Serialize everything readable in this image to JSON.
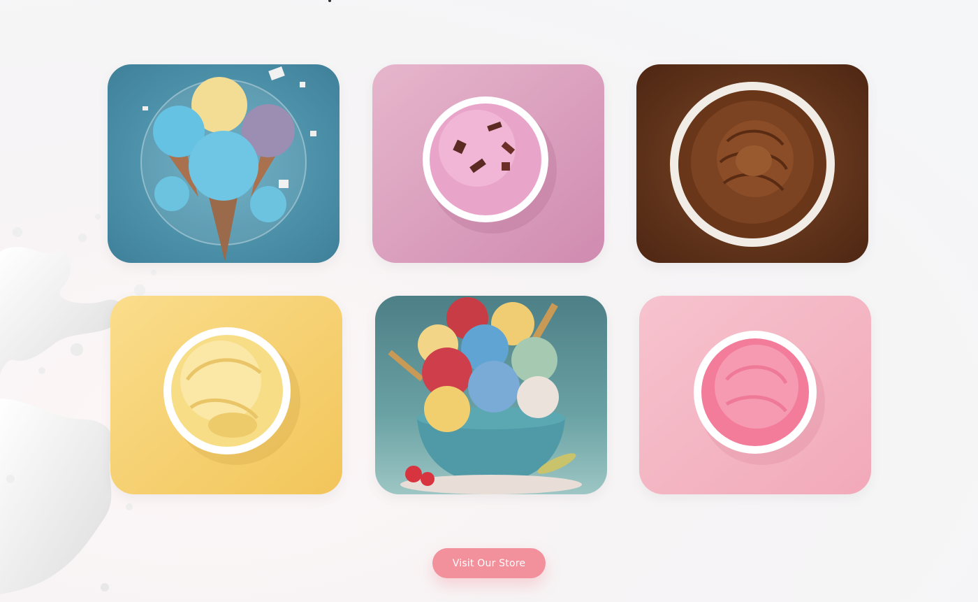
{
  "gallery": {
    "cards": [
      {
        "icon": "ice-cream-cones-bowl-image",
        "bg": "#4a8ea6",
        "accent": "#6cc3e0"
      },
      {
        "icon": "strawberry-chocolate-cup-image",
        "bg": "#dca6c2",
        "accent": "#e89ac0"
      },
      {
        "icon": "chocolate-cup-image",
        "bg": "#6b3a1f",
        "accent": "#7a4424"
      },
      {
        "icon": "vanilla-cup-image",
        "bg": "#f7d27a",
        "accent": "#fbe3a0"
      },
      {
        "icon": "scoop-sundae-bowl-image",
        "bg": "#5d8f8c",
        "accent": "#4f9aa6"
      },
      {
        "icon": "strawberry-cup-image",
        "bg": "#f4b6c4",
        "accent": "#f28ba3"
      }
    ]
  },
  "cta": {
    "label": "Visit Our Store",
    "color": "#f2909b"
  }
}
